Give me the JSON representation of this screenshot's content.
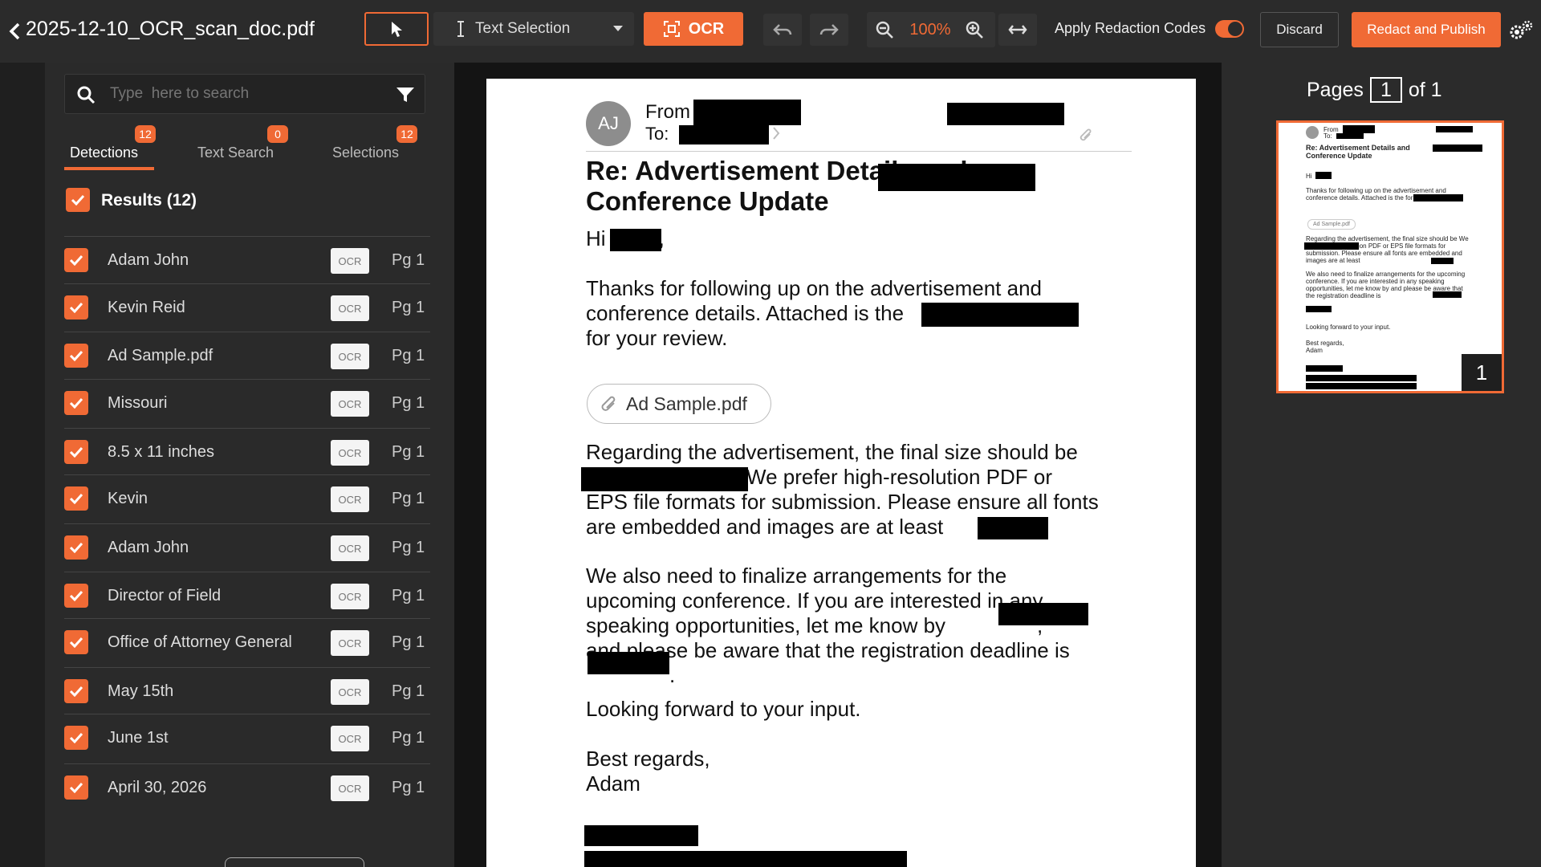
{
  "header": {
    "doc_title": "2025-12-10_OCR_scan_doc.pdf",
    "text_selection_label": "Text Selection",
    "ocr_label": "OCR",
    "zoom": "100%",
    "apply_redaction_label": "Apply Redaction Codes",
    "apply_redaction_on": true,
    "discard_label": "Discard",
    "publish_label": "Redact and Publish"
  },
  "sidebar": {
    "search_placeholder": "Type  here to search",
    "tabs": [
      {
        "label": "Detections",
        "count": "12"
      },
      {
        "label": "Text Search",
        "count": "0"
      },
      {
        "label": "Selections",
        "count": "12"
      }
    ],
    "results_label": "Results (12)",
    "ocr_tag": "OCR",
    "rows": [
      {
        "label": "Adam John",
        "page": "Pg 1"
      },
      {
        "label": "Kevin Reid",
        "page": "Pg 1"
      },
      {
        "label": "Ad Sample.pdf",
        "page": "Pg 1"
      },
      {
        "label": "Missouri",
        "page": "Pg 1"
      },
      {
        "label": "8.5 x 11 inches",
        "page": "Pg 1"
      },
      {
        "label": "Kevin",
        "page": "Pg 1"
      },
      {
        "label": "Adam John",
        "page": "Pg 1"
      },
      {
        "label": "Director of Field",
        "page": "Pg 1"
      },
      {
        "label": "Office of Attorney General",
        "page": "Pg 1"
      },
      {
        "label": "May 15th",
        "page": "Pg 1"
      },
      {
        "label": "June 1st",
        "page": "Pg 1"
      },
      {
        "label": "April 30, 2026",
        "page": "Pg 1"
      }
    ]
  },
  "document": {
    "avatar_initials": "AJ",
    "from_label": "From",
    "to_label": "To:",
    "subject_line1": "Re: Advertisement Details and",
    "subject_line2": "Conference Update",
    "greeting": "Hi",
    "greeting_end": ",",
    "p1_line1": "Thanks for following up on the advertisement and",
    "p1_line2": "conference details. Attached is the",
    "p1_line3": "for your review.",
    "attachment": "Ad Sample.pdf",
    "p2_line1": "Regarding the advertisement, the final size should be",
    "p2_line2": "We prefer high-resolution PDF or",
    "p2_line3": "EPS file formats for submission. Please ensure all fonts",
    "p2_line4": "are embedded and images are at least",
    "p2_line4_end": ".",
    "p3_line1": "We also need to finalize arrangements for the",
    "p3_line2": "upcoming conference. If you are interested in any",
    "p3_line3": "speaking opportunities, let me know by",
    "p3_line3_end": ",",
    "p3_line4": "and please be aware that the registration deadline is",
    "p3_line5_end": ".",
    "p4": "Looking forward to your input.",
    "signoff": "Best regards,",
    "signoff_name": "Adam"
  },
  "thumbnail_panel": {
    "pages_label": "Pages",
    "current_page": "1",
    "of_label": "of 1",
    "thumb_page_number": "1",
    "thumb_subject": "Re: Advertisement Details and Conference Update",
    "thumb_from": "From",
    "thumb_to": "To:",
    "thumb_greeting": "Hi",
    "thumb_p1": "Thanks for following up on the advertisement and conference details. Attached is the for your review.",
    "thumb_attachment": "Ad Sample.pdf",
    "thumb_p2": "Regarding the advertisement, the final size should be We prefer high-resolution PDF or EPS file formats for submission. Please ensure all fonts are embedded and images are at least",
    "thumb_p3": "We also need to finalize arrangements for the upcoming conference. If you are interested in any speaking opportunities, let me know by and please be aware that the registration deadline is",
    "thumb_p4": "Looking forward to your input.",
    "thumb_signoff": "Best regards,",
    "thumb_signoff_name": "Adam"
  },
  "colors": {
    "accent": "#f06a35",
    "topbar": "#2b2b2b",
    "panel": "#2a2a2a",
    "background": "#1f1f1f"
  }
}
